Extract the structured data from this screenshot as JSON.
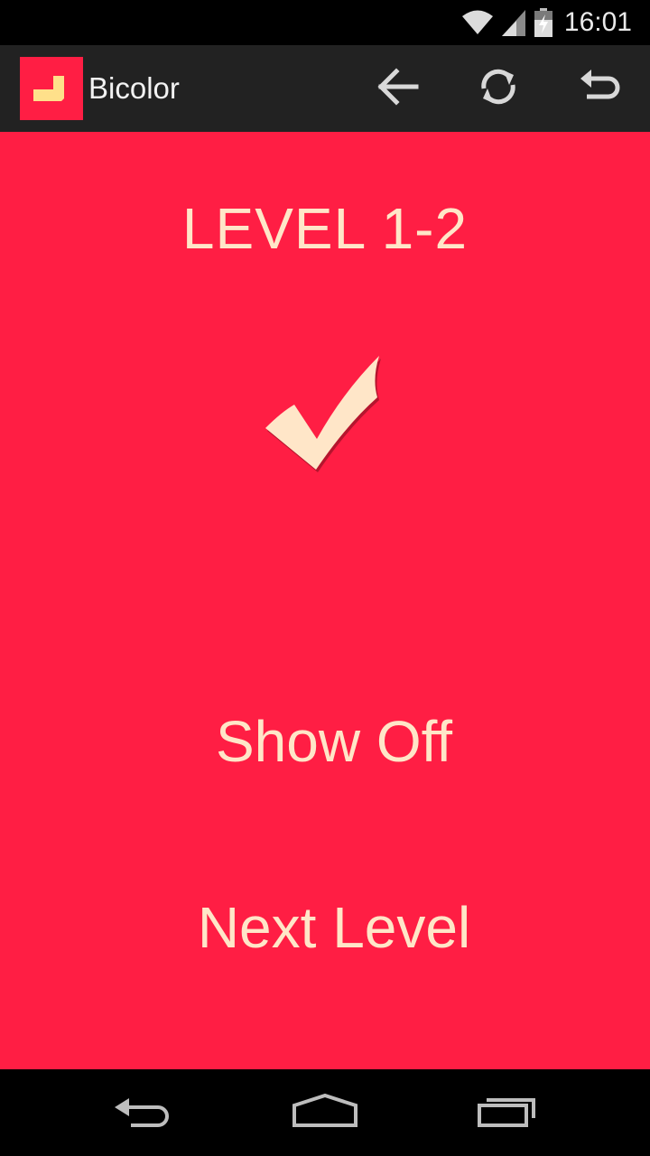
{
  "status_bar": {
    "time": "16:01",
    "icons": [
      "wifi-icon",
      "signal-icon",
      "battery-charging-icon"
    ]
  },
  "action_bar": {
    "title": "Bicolor",
    "icons": [
      "app-logo-icon",
      "arrow-left-icon",
      "restart-icon",
      "undo-icon"
    ]
  },
  "main": {
    "level_label": "LEVEL 1-2",
    "status_icon": "checkmark-icon",
    "show_off_label": "Show Off",
    "next_level_label": "Next Level"
  },
  "nav_bar": {
    "icons": [
      "nav-back-icon",
      "nav-home-icon",
      "nav-recents-icon"
    ]
  },
  "colors": {
    "accent": "#ff1e44",
    "foreground": "#ffe6c8",
    "action_bar": "#222222",
    "system_bars": "#000000"
  }
}
